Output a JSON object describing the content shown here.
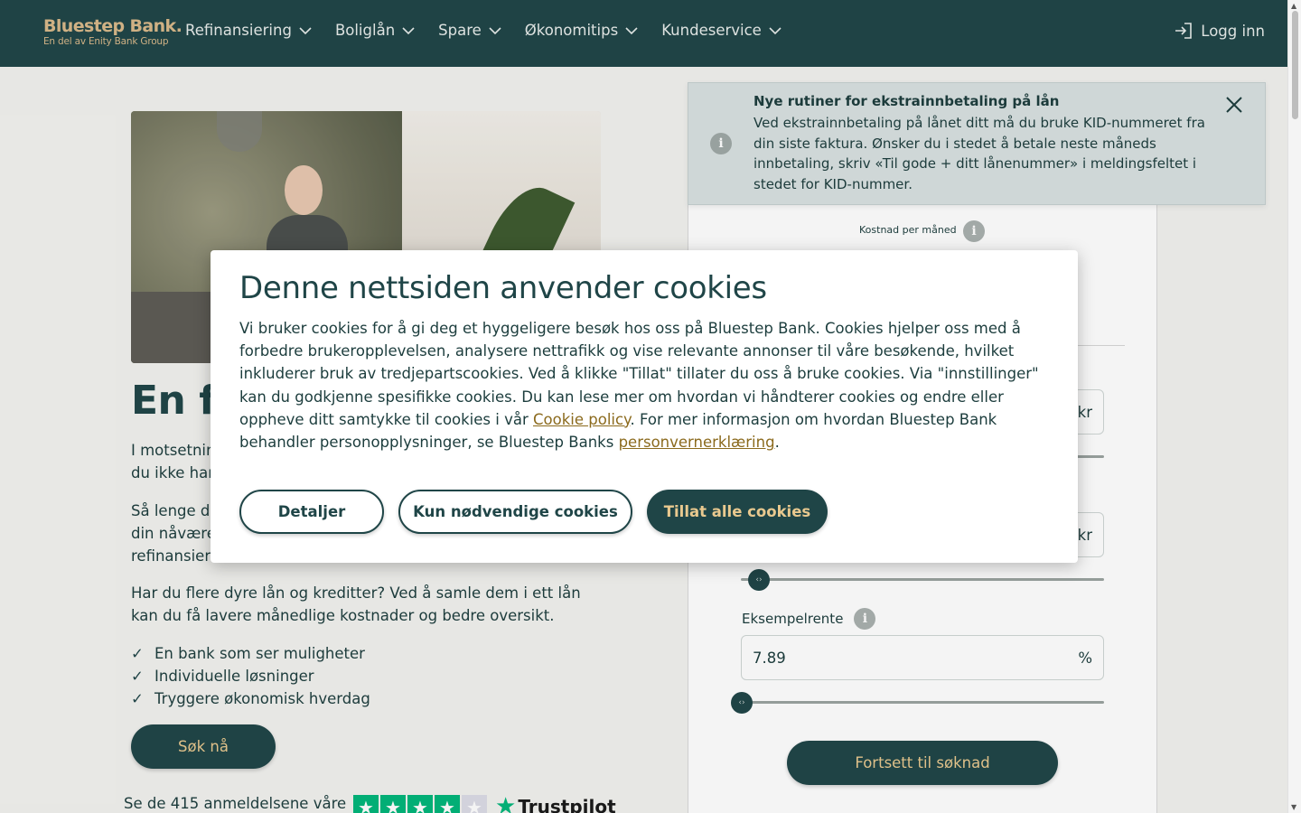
{
  "header": {
    "logo_brand": "Bluestep Bank.",
    "logo_sub": "En del av Enity Bank Group",
    "nav": [
      {
        "label": "Refinansiering"
      },
      {
        "label": "Boliglån"
      },
      {
        "label": "Spare"
      },
      {
        "label": "Økonomitips"
      },
      {
        "label": "Kundeservice"
      }
    ],
    "login_label": "Logg inn"
  },
  "hero": {
    "title": "En fo",
    "p1": "I motsetnin… du ikke har",
    "p1_line1": "I motsetnin",
    "p1_line2": "du ikke har",
    "p2_line1": "Så lenge d",
    "p2_line2": "din nåvære",
    "p2_line3": "refinansieri",
    "p3": "Har du flere dyre lån og kreditter? Ved å samle dem i ett lån kan du få lavere månedlige kostnader og bedre oversikt.",
    "checks": [
      "En bank som ser muligheter",
      "Individuelle løsninger",
      "Tryggere økonomisk hverdag"
    ],
    "apply_label": "Søk nå",
    "reviews_prefix": "Se de",
    "reviews_count": "415",
    "reviews_suffix": "anmeldelsene våre",
    "trustpilot_label": "Trustpilot",
    "trustpilot_rating_stars": 4
  },
  "notice": {
    "title": "Nye rutiner for ekstrainnbetaling på lån",
    "body": "Ved ekstrainnbetaling på lånet ditt må du bruke KID-nummeret fra din siste faktura. Ønsker du i stedet å betale neste måneds innbetaling, skriv «Til gode + ditt lånenummer» i meldingsfeltet i stedet for KID-nummer."
  },
  "calculator": {
    "cost_label": "Kostnad per måned",
    "field1_unit": "kr",
    "field2_unit": "kr",
    "rate_label": "Eksempelrente",
    "rate_value": "7.89",
    "rate_unit": "%",
    "continue_label": "Fortsett til søknad"
  },
  "cookie_modal": {
    "title": "Denne nettsiden anvender cookies",
    "body_part1": "Vi bruker cookies for å gi deg et hyggeligere besøk hos oss på Bluestep Bank. Cookies hjelper oss med å forbedre brukeropplevelsen, analysere nettrafikk og vise relevante annonser til våre besøkende, hvilket inkluderer bruk av tredjepartscookies. Ved å klikke \"Tillat\" tillater du oss å bruke cookies. Via \"innstillinger\" kan du godkjenne spesifikke cookies. Du kan lese mer om hvordan vi håndterer cookies og endre eller oppheve ditt samtykke til cookies i vår ",
    "cookie_policy_link": "Cookie policy",
    "body_part2": ". For mer informasjon om hvordan Bluestep Bank behandler personopplysninger, se Bluestep Banks ",
    "privacy_link": "personvernerklæring",
    "body_part3": ".",
    "btn_details": "Detaljer",
    "btn_necessary": "Kun nødvendige cookies",
    "btn_allow": "Tillat alle cookies"
  },
  "colors": {
    "brand_dark": "#1f4547",
    "brand_gold": "#e9c98f",
    "link": "#8b6a1d",
    "trustpilot_green": "#00b67a"
  }
}
